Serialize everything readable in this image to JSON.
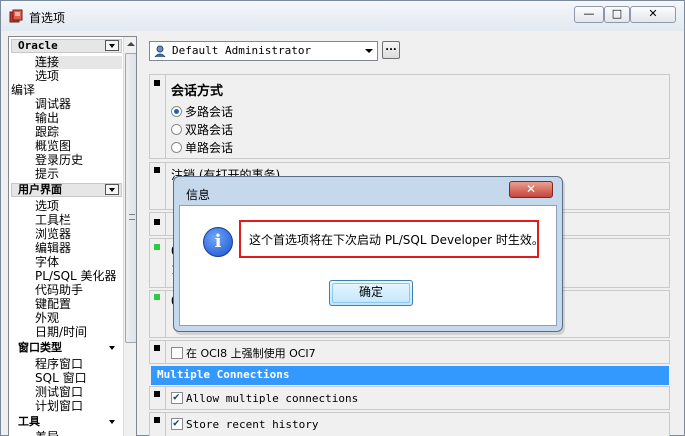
{
  "window": {
    "title": "首选项",
    "min_label": "—",
    "max_label": "□",
    "close_label": "✕"
  },
  "tree": {
    "oracle": {
      "label": "Oracle",
      "items": [
        "连接",
        "选项"
      ]
    },
    "compile_label": "编译",
    "more_items": [
      "调试器",
      "输出",
      "跟踪",
      "概览图",
      "登录历史",
      "提示"
    ],
    "ui": {
      "label": "用户界面",
      "items": [
        "选项",
        "工具栏",
        "浏览器",
        "编辑器",
        "字体",
        "PL/SQL 美化器",
        "代码助手",
        "键配置",
        "外观",
        "日期/时间"
      ]
    },
    "window_types": {
      "label": "窗口类型",
      "items": [
        "程序窗口",
        "SQL 窗口",
        "测试窗口",
        "计划窗口"
      ]
    },
    "tools": {
      "label": "工具",
      "items": [
        "差异"
      ]
    }
  },
  "user_combo": {
    "value": "Default Administrator",
    "ellipsis": "..."
  },
  "session": {
    "title": "会话方式",
    "options": [
      {
        "label": "多路会话",
        "checked": true
      },
      {
        "label": "双路会话",
        "checked": false
      },
      {
        "label": "单路会话",
        "checked": false
      }
    ]
  },
  "logout": {
    "label": "注销 (有打开的事务)"
  },
  "partial_rows": [
    "O",
    "1",
    "O"
  ],
  "oci8": {
    "label_prefix": "在 OCI8 上强制使用 OCI7",
    "checked": false
  },
  "multiple_connections": {
    "header": "Multiple Connections",
    "allow_label": "Allow multiple connections",
    "allow_checked": true,
    "store_label": "Store recent history",
    "store_checked": true
  },
  "dialog": {
    "title": "信息",
    "close_label": "✕",
    "message": "这个首选项将在下次启动 PL/SQL Developer 时生效。",
    "ok_label": "确定",
    "info_glyph": "i"
  }
}
